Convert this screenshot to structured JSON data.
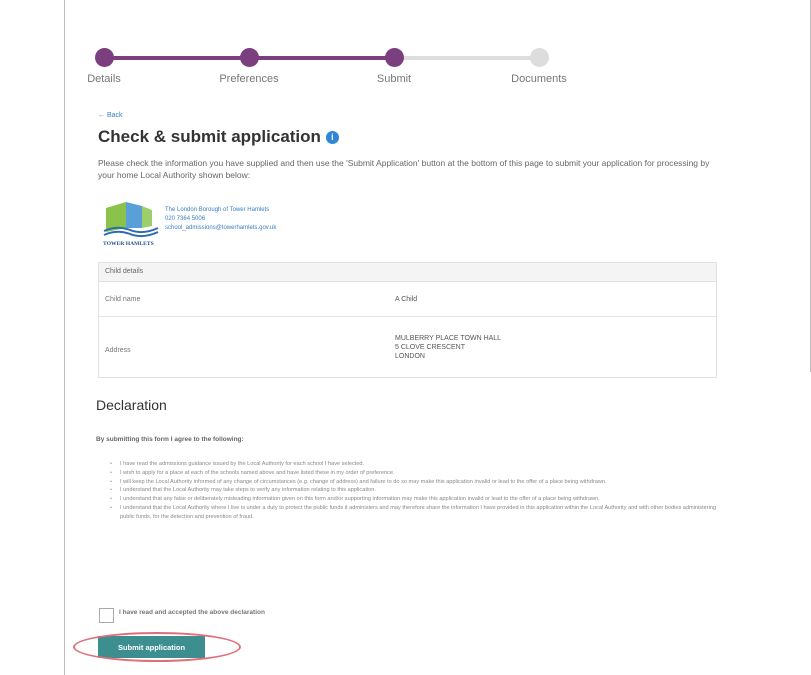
{
  "steps": [
    {
      "label": "Details",
      "state": "complete"
    },
    {
      "label": "Preferences",
      "state": "complete"
    },
    {
      "label": "Submit",
      "state": "current"
    },
    {
      "label": "Documents",
      "state": "pending"
    }
  ],
  "colors": {
    "step_active": "#7b3f7f",
    "step_inactive": "#dddddd",
    "button": "#3d8f8f",
    "info_icon": "#2f85d6",
    "highlight": "#de6f7a"
  },
  "back_link": "← Back",
  "page_title": "Check & submit application",
  "info_icon_glyph": "i",
  "intro_text": "Please check the information you have supplied and then use the 'Submit Application' button at the bottom of this page to submit your application for processing by your home Local Authority shown below:",
  "local_authority": {
    "logo_text": "TOWER HAMLETS",
    "name": "The London Borough of Tower Hamlets",
    "phone": "020 7364 5006",
    "email": "school_admissions@towerhamlets.gov.uk"
  },
  "child_details": {
    "header": "Child details",
    "rows": [
      {
        "label": "Child name",
        "value": "A Child"
      },
      {
        "label": "Address",
        "value_lines": [
          "MULBERRY PLACE TOWN HALL",
          "5 CLOVE CRESCENT",
          "LONDON"
        ]
      }
    ]
  },
  "declaration": {
    "title": "Declaration",
    "intro": "By submitting this form I agree to the following:",
    "items": [
      "I have read the admissions guidance issued by the Local Authority for each school I have selected.",
      "I wish to apply for a place at each of the schools named above and have listed these in my order of preference.",
      "I will keep the Local Authority informed of any change of circumstances (e.g. change of address) and failure to do so may make this application invalid or lead to the offer of a place being withdrawn.",
      "I understand that the Local Authority may take steps to verify any information relating to this application.",
      "I understand that any false or deliberately misleading information given on this form and/or supporting information may make this application invalid or lead to the offer of a place being withdrawn.",
      "I understand that the Local Authority where I live is under a duty to protect the public funds it administers and may therefore share the information I have provided in this application within the Local Authority and with other bodies administering public funds, for the detection and prevention of fraud."
    ],
    "checkbox_label": "I have read and accepted the above declaration",
    "checkbox_checked": false
  },
  "submit_button": "Submit application"
}
